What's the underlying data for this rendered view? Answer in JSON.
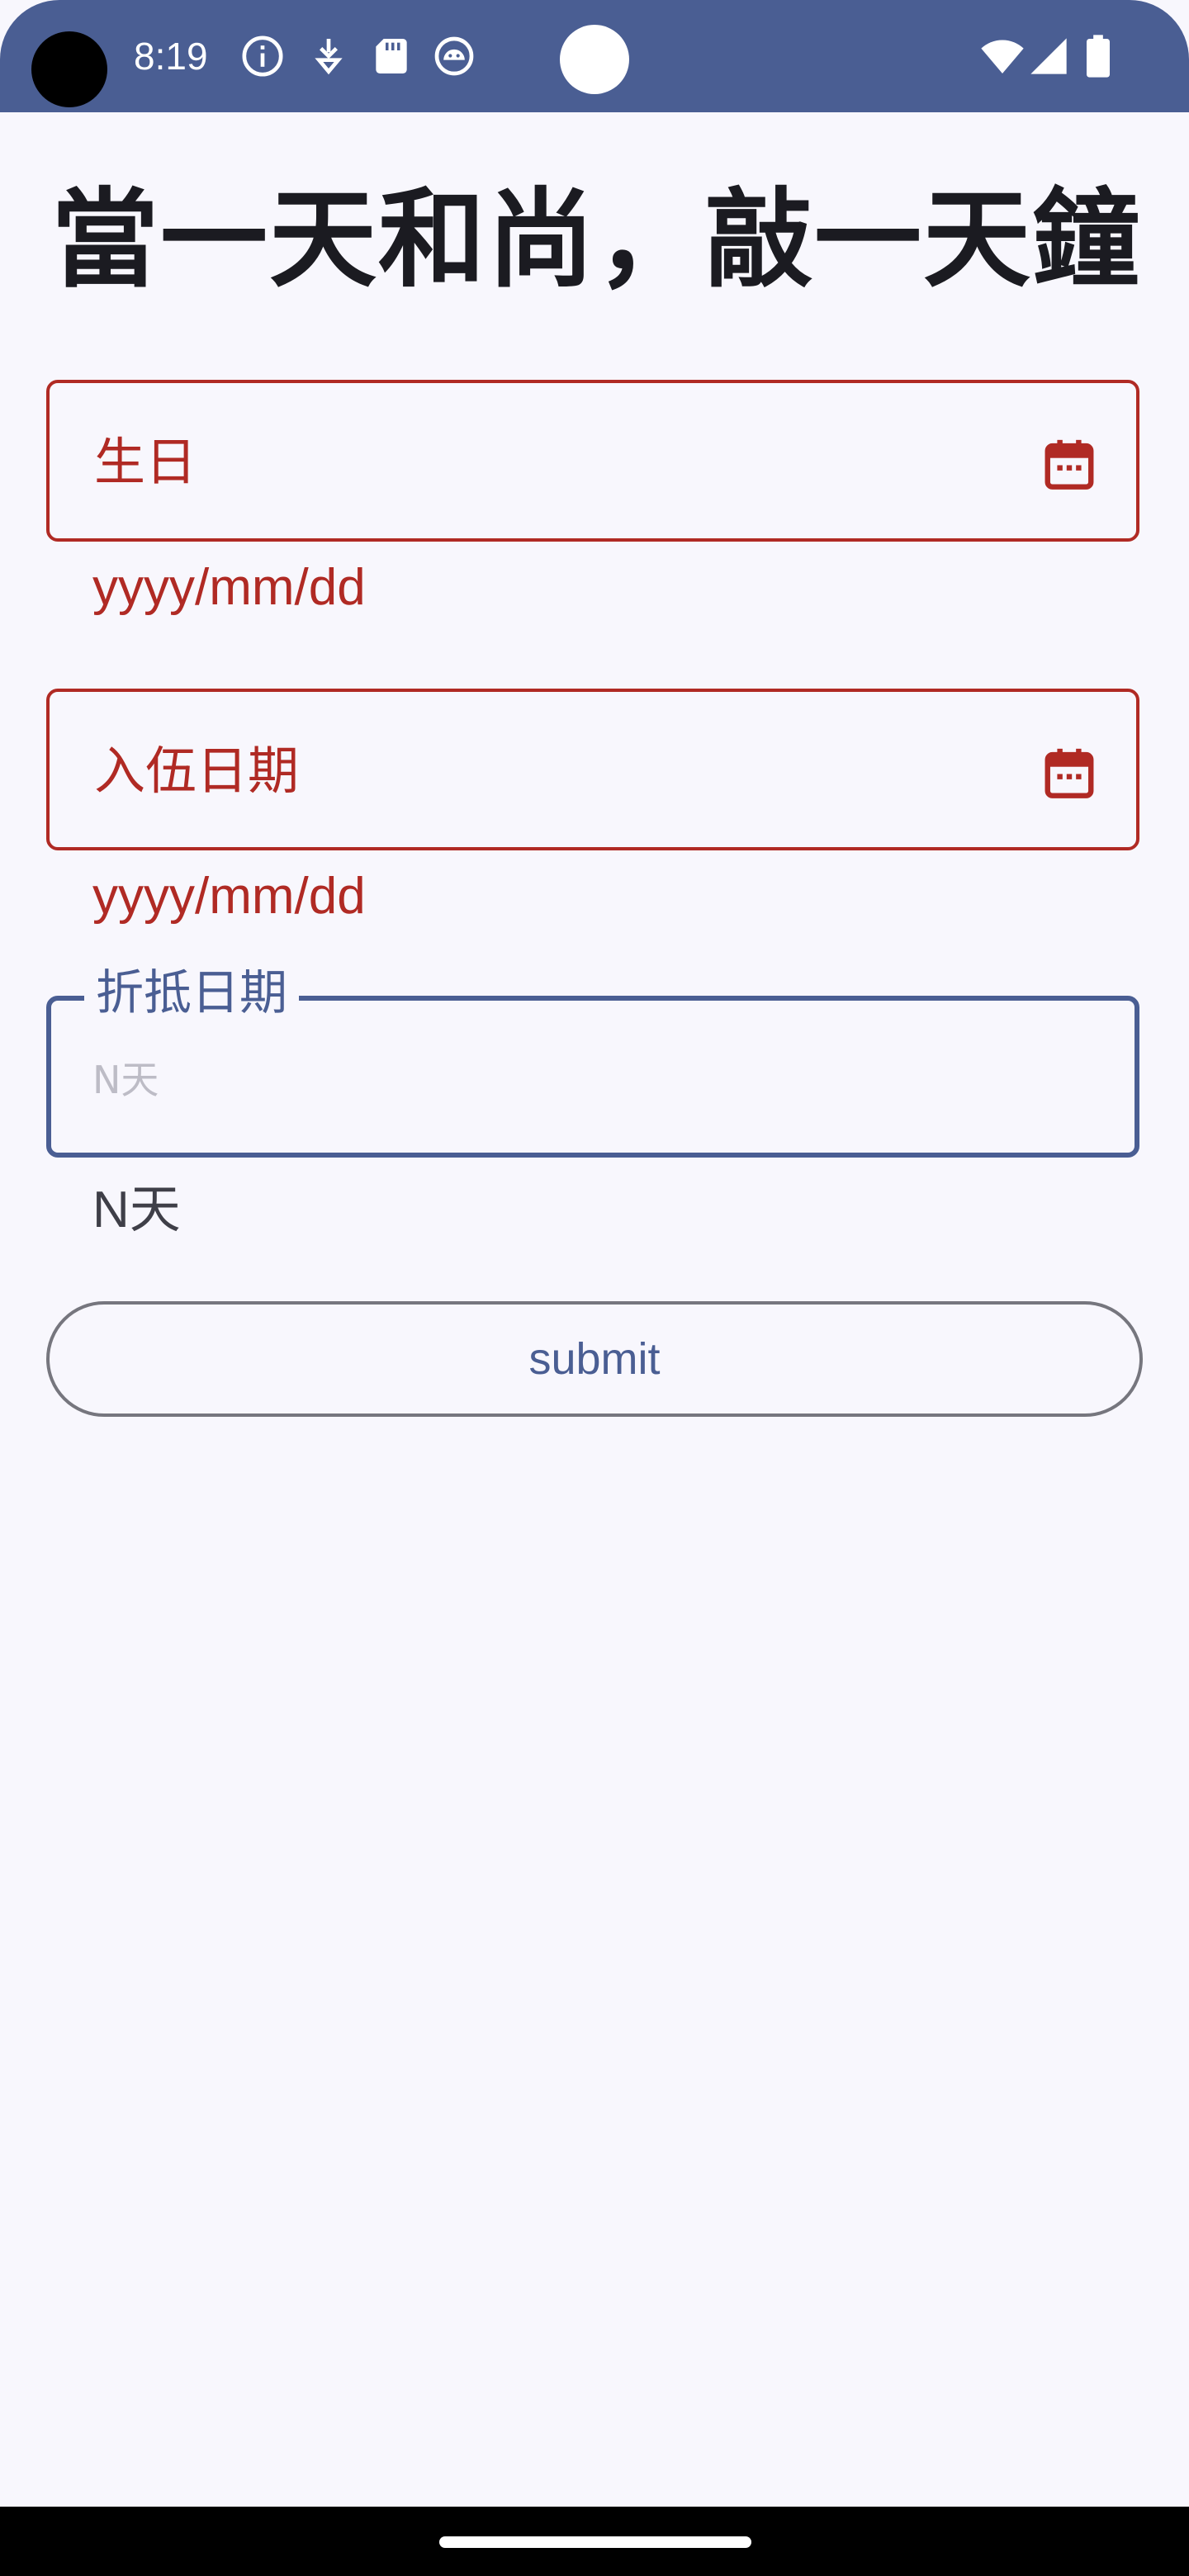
{
  "status_bar": {
    "time": "8:19",
    "icons": [
      "info-icon",
      "download-icon",
      "sd-card-icon",
      "android-icon",
      "wifi-icon",
      "signal-icon",
      "battery-icon"
    ],
    "color": "#4a5e93"
  },
  "page": {
    "title": "當一天和尚，敲一天鐘"
  },
  "fields": {
    "birthday": {
      "label": "生日",
      "helper": "yyyy/mm/dd",
      "icon": "calendar-icon"
    },
    "enlist_date": {
      "label": "入伍日期",
      "helper": "yyyy/mm/dd",
      "icon": "calendar-icon"
    },
    "discount_days": {
      "label": "折抵日期",
      "placeholder": "N天",
      "helper": "N天"
    }
  },
  "submit": {
    "label": "submit"
  },
  "colors": {
    "error": "#b02a24",
    "primary": "#4a5e93",
    "background": "#f8f7fd"
  }
}
